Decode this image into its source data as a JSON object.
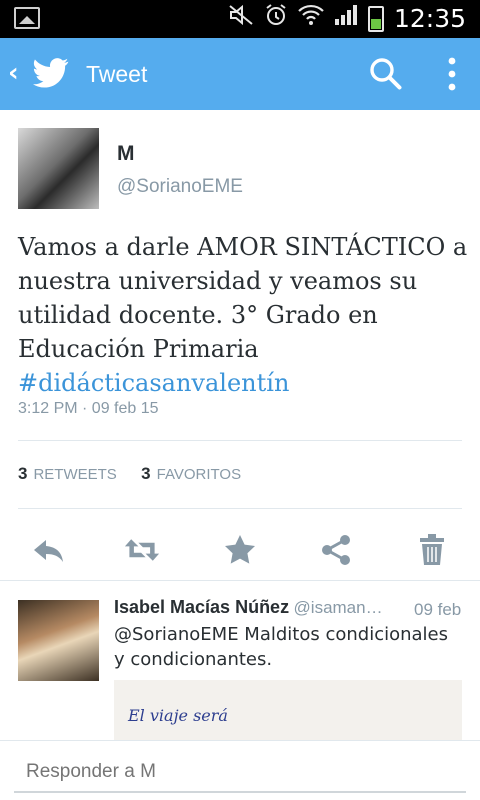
{
  "status_bar": {
    "time": "12:35",
    "icons": [
      "gallery-icon",
      "mute-icon",
      "alarm-icon",
      "wifi-icon",
      "signal-icon",
      "battery-icon"
    ],
    "battery_color": "#6cc644"
  },
  "app_bar": {
    "title": "Tweet",
    "color": "#55acee",
    "icons": [
      "back-icon",
      "twitter-bird-icon",
      "search-icon",
      "overflow-menu-icon"
    ]
  },
  "tweet": {
    "author_name": "M",
    "author_handle": "@SorianoEME",
    "text": "Vamos a darle AMOR SINTÁCTICO a nuestra universidad y veamos su utilidad docente. 3° Grado en Educación Primaria",
    "hashtag": "#didácticasanvalentín",
    "timestamp": "3:12 PM · 09 feb 15",
    "retweets_count": "3",
    "retweets_label": "RETWEETS",
    "favorites_count": "3",
    "favorites_label": "FAVORITOS",
    "actions": [
      "reply-icon",
      "retweet-icon",
      "favorite-icon",
      "share-icon",
      "delete-icon"
    ]
  },
  "reply": {
    "author_name": "Isabel Macías Núñez",
    "author_handle": "@isaman…",
    "date": "09 feb",
    "text": "@SorianoEME Malditos condicionales y condicionantes.",
    "media_handwriting": "El viaje será"
  },
  "composer": {
    "placeholder": "Responder a M"
  }
}
